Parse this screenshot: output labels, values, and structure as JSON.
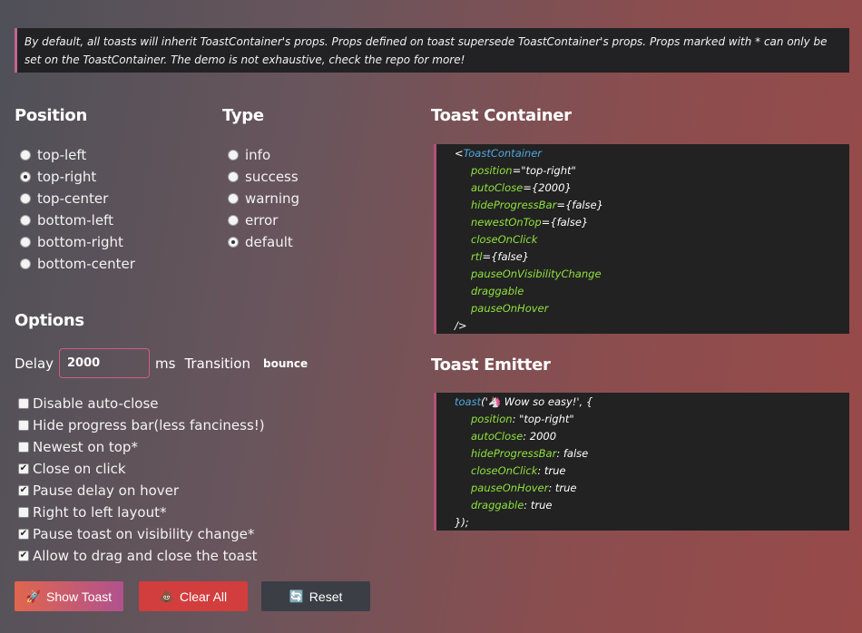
{
  "notice": "By default, all toasts will inherit ToastContainer's props. Props defined on toast supersede ToastContainer's props. Props marked with * can only be set on the ToastContainer. The demo is not exhaustive, check the repo for more!",
  "position": {
    "title": "Position",
    "options": [
      {
        "label": "top-left",
        "checked": false
      },
      {
        "label": "top-right",
        "checked": true
      },
      {
        "label": "top-center",
        "checked": false
      },
      {
        "label": "bottom-left",
        "checked": false
      },
      {
        "label": "bottom-right",
        "checked": false
      },
      {
        "label": "bottom-center",
        "checked": false
      }
    ]
  },
  "type": {
    "title": "Type",
    "options": [
      {
        "label": "info",
        "checked": false
      },
      {
        "label": "success",
        "checked": false
      },
      {
        "label": "warning",
        "checked": false
      },
      {
        "label": "error",
        "checked": false
      },
      {
        "label": "default",
        "checked": true
      }
    ]
  },
  "options": {
    "title": "Options",
    "delay_label": "Delay",
    "delay_value": "2000",
    "delay_unit": "ms",
    "transition_label": "Transition",
    "transition_value": "bounce",
    "checkboxes": [
      {
        "label": "Disable auto-close",
        "checked": false
      },
      {
        "label": "Hide progress bar(less fanciness!)",
        "checked": false
      },
      {
        "label": "Newest on top*",
        "checked": false
      },
      {
        "label": "Close on click",
        "checked": true
      },
      {
        "label": "Pause delay on hover",
        "checked": true
      },
      {
        "label": "Right to left layout*",
        "checked": false
      },
      {
        "label": "Pause toast on visibility change*",
        "checked": true
      },
      {
        "label": "Allow to drag and close the toast",
        "checked": true
      }
    ]
  },
  "buttons": {
    "show": {
      "label": "Show Toast",
      "icon": "🚀"
    },
    "clear": {
      "label": "Clear All",
      "icon": "💩"
    },
    "reset": {
      "label": "Reset",
      "icon": "🔄"
    }
  },
  "container_code": {
    "title": "Toast Container",
    "open": "<",
    "tag": "ToastContainer",
    "props": [
      {
        "name": "position",
        "value": "=\"top-right\""
      },
      {
        "name": "autoClose",
        "value": "={2000}"
      },
      {
        "name": "hideProgressBar",
        "value": "={false}"
      },
      {
        "name": "newestOnTop",
        "value": "={false}"
      },
      {
        "name": "closeOnClick",
        "value": ""
      },
      {
        "name": "rtl",
        "value": "={false}"
      },
      {
        "name": "pauseOnVisibilityChange",
        "value": ""
      },
      {
        "name": "draggable",
        "value": ""
      },
      {
        "name": "pauseOnHover",
        "value": ""
      }
    ],
    "close": "/>"
  },
  "emitter_code": {
    "title": "Toast Emitter",
    "fn": "toast",
    "call_open": "('🦄 Wow so easy!', {",
    "props": [
      {
        "name": "position",
        "value": ": \"top-right\""
      },
      {
        "name": "autoClose",
        "value": ": 2000"
      },
      {
        "name": "hideProgressBar",
        "value": ": false"
      },
      {
        "name": "closeOnClick",
        "value": ": true"
      },
      {
        "name": "pauseOnHover",
        "value": ": true"
      },
      {
        "name": "draggable",
        "value": ": true"
      }
    ],
    "close": "});"
  }
}
